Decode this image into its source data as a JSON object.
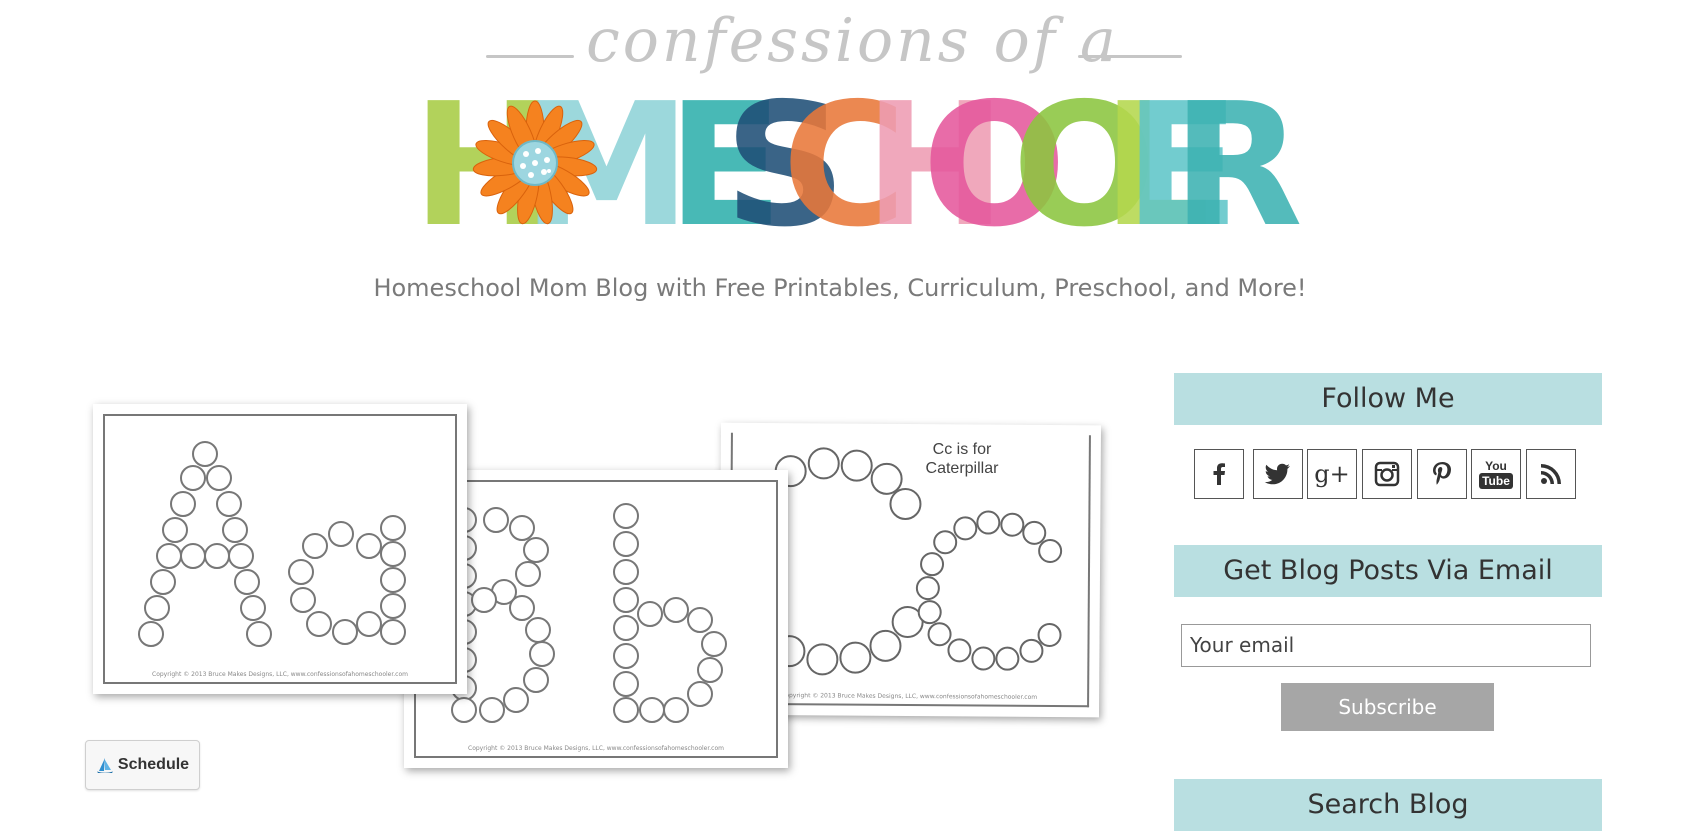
{
  "header": {
    "logo_script": "confessions of a",
    "logo_word": "HOMESCHOOLER",
    "logo_colors": [
      "#a8cc45",
      "#f5821f",
      "#8fd3d8",
      "#2fb0ad",
      "#1f4f77",
      "#e9783a",
      "#ee9db3",
      "#e5589d",
      "#8cc63f",
      "#b5d84e",
      "#5fc5c9",
      "#3db2b2"
    ],
    "tagline": "Homeschool Mom Blog with Free Printables, Curriculum, Preschool, and More!"
  },
  "hero_image": {
    "cards": [
      "Aa",
      "Bb",
      "Cc"
    ],
    "cc_label_line1": "Cc is for",
    "cc_label_line2": "Caterpillar",
    "copyright": "Copyright © 2013 Bruce Makes Designs, LLC, www.confessionsofahomeschooler.com"
  },
  "schedule_button": {
    "label": "Schedule",
    "icon": "sailboat-icon"
  },
  "sidebar": {
    "follow_title": "Follow Me",
    "social_icons": [
      "facebook-icon",
      "twitter-icon",
      "google-plus-icon",
      "instagram-icon",
      "pinterest-icon",
      "youtube-icon",
      "rss-icon"
    ],
    "google_plus_text": "g+",
    "youtube_top": "You",
    "youtube_bottom": "Tube",
    "email_title": "Get Blog Posts Via Email",
    "email_placeholder": "Your email",
    "subscribe_label": "Subscribe",
    "search_title": "Search Blog"
  }
}
